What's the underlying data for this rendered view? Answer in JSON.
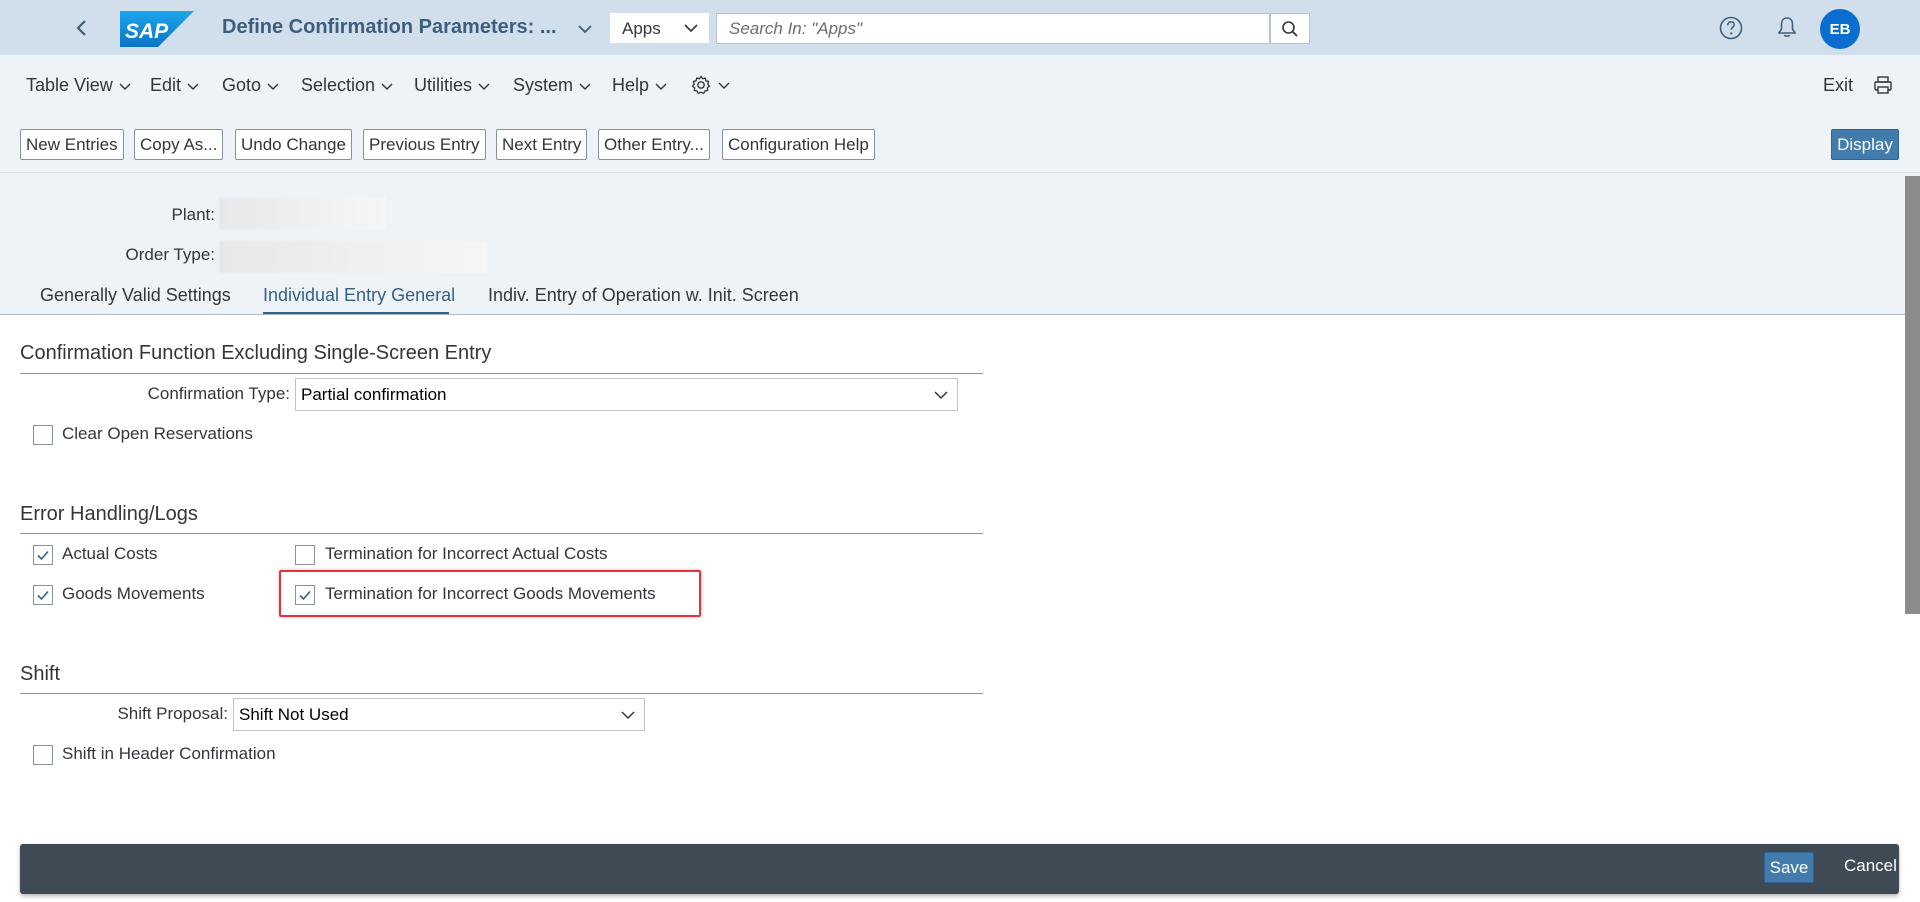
{
  "shell": {
    "logo_text": "SAP",
    "app_title": "Define Confirmation Parameters: ...",
    "scope": "Apps",
    "search_placeholder": "Search In: \"Apps\"",
    "avatar_initials": "EB",
    "brand_color": "#0a6ed1"
  },
  "menu": {
    "items": [
      "Table View",
      "Edit",
      "Goto",
      "Selection",
      "Utilities",
      "System",
      "Help"
    ],
    "exit_label": "Exit"
  },
  "toolbar": {
    "buttons": [
      "New Entries",
      "Copy As...",
      "Undo Change",
      "Previous Entry",
      "Next Entry",
      "Other Entry...",
      "Configuration Help"
    ],
    "display_label": "Display"
  },
  "header": {
    "plant_label": "Plant:",
    "order_type_label": "Order Type:"
  },
  "tabs": {
    "items": [
      "Generally Valid Settings",
      "Individual Entry General",
      "Indiv. Entry of Operation w. Init. Screen"
    ],
    "active_index": 1
  },
  "confirmation_section": {
    "title": "Confirmation Function Excluding Single-Screen Entry",
    "confirmation_type_label": "Confirmation Type:",
    "confirmation_type_value": "Partial confirmation",
    "clear_open_reservations_label": "Clear Open Reservations",
    "clear_open_reservations_checked": false
  },
  "error_section": {
    "title": "Error Handling/Logs",
    "actual_costs_label": "Actual Costs",
    "actual_costs_checked": true,
    "goods_movements_label": "Goods Movements",
    "goods_movements_checked": true,
    "term_actual_costs_label": "Termination for Incorrect Actual Costs",
    "term_actual_costs_checked": false,
    "term_goods_movements_label": "Termination for Incorrect Goods Movements",
    "term_goods_movements_checked": true,
    "highlight_color": "#e0333b"
  },
  "shift_section": {
    "title": "Shift",
    "shift_proposal_label": "Shift Proposal:",
    "shift_proposal_value": "Shift Not Used",
    "shift_header_label": "Shift in Header Confirmation",
    "shift_header_checked": false
  },
  "footer": {
    "save_label": "Save",
    "cancel_label": "Cancel"
  }
}
